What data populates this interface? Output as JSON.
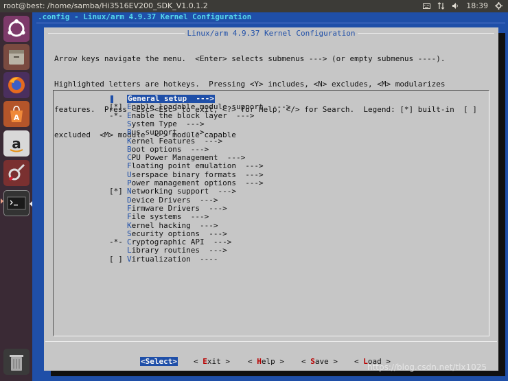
{
  "topbar": {
    "window_title": "root@best: /home/samba/Hi3516EV200_SDK_V1.0.1.2",
    "time": "18:39"
  },
  "launcher": {
    "items": [
      {
        "name": "ubuntu-dash-icon"
      },
      {
        "name": "files-icon"
      },
      {
        "name": "firefox-icon"
      },
      {
        "name": "software-center-icon"
      },
      {
        "name": "amazon-icon"
      },
      {
        "name": "system-settings-icon"
      },
      {
        "name": "terminal-icon"
      },
      {
        "name": "trash-icon"
      }
    ]
  },
  "terminal": {
    "header": ".config - Linux/arm 4.9.37 Kernel Configuration",
    "dialog_title": "Linux/arm 4.9.37 Kernel Configuration",
    "help_lines": [
      "Arrow keys navigate the menu.  <Enter> selects submenus ---> (or empty submenus ----).",
      "Highlighted letters are hotkeys.  Pressing <Y> includes, <N> excludes, <M> modularizes",
      "features.  Press <Esc><Esc> to exit, <?> for Help, </> for Search.  Legend: [*] built-in  [ ]",
      "excluded  <M> module  < > module capable"
    ]
  },
  "menu": {
    "items": [
      {
        "mark": "",
        "hot": "G",
        "rest": "eneral setup  --->",
        "selected": true
      },
      {
        "mark": "[*]",
        "hot": "E",
        "rest": "nable loadable module support  --->"
      },
      {
        "mark": "-*-",
        "hot": "E",
        "rest": "nable the block layer  --->"
      },
      {
        "mark": "",
        "hot": "S",
        "rest": "ystem Type  --->"
      },
      {
        "mark": "",
        "hot": "B",
        "rest": "us support  --->"
      },
      {
        "mark": "",
        "hot": "K",
        "rest": "ernel Features  --->"
      },
      {
        "mark": "",
        "hot": "B",
        "rest": "oot options  --->"
      },
      {
        "mark": "",
        "hot": "C",
        "rest": "PU Power Management  --->"
      },
      {
        "mark": "",
        "hot": "F",
        "rest": "loating point emulation  --->"
      },
      {
        "mark": "",
        "hot": "U",
        "rest": "serspace binary formats  --->"
      },
      {
        "mark": "",
        "hot": "P",
        "rest": "ower management options  --->"
      },
      {
        "mark": "[*]",
        "hot": "N",
        "rest": "etworking support  --->"
      },
      {
        "mark": "",
        "hot": "D",
        "rest": "evice Drivers  --->"
      },
      {
        "mark": "",
        "hot": "F",
        "rest": "irmware Drivers  --->"
      },
      {
        "mark": "",
        "hot": "F",
        "rest": "ile systems  --->"
      },
      {
        "mark": "",
        "hot": "K",
        "rest": "ernel hacking  --->"
      },
      {
        "mark": "",
        "hot": "S",
        "rest": "ecurity options  --->"
      },
      {
        "mark": "-*-",
        "hot": "C",
        "rest": "ryptographic API  --->"
      },
      {
        "mark": "",
        "hot": "L",
        "rest": "ibrary routines  --->"
      },
      {
        "mark": "[ ]",
        "hot": "V",
        "rest": "irtualization  ----"
      }
    ]
  },
  "buttons": {
    "select": {
      "open": "<",
      "hot": "S",
      "rest": "elect",
      "close": ">"
    },
    "exit": {
      "open": "< ",
      "hot": "E",
      "rest": "xit",
      "close": " >"
    },
    "help": {
      "open": "< ",
      "hot": "H",
      "rest": "elp",
      "close": " >"
    },
    "save": {
      "open": "< ",
      "hot": "S",
      "rest": "ave",
      "close": " >"
    },
    "load": {
      "open": "< ",
      "hot": "L",
      "rest": "oad",
      "close": " >"
    }
  },
  "watermark": "https://blog.csdn.net/tlx1025",
  "colors": {
    "terminal_bg": "#1f4fa8",
    "dialog_bg": "#c6c6c6",
    "hotkey": "#1f4fa8",
    "button_hotkey": "#b80000",
    "header_text": "#56d6e9"
  }
}
